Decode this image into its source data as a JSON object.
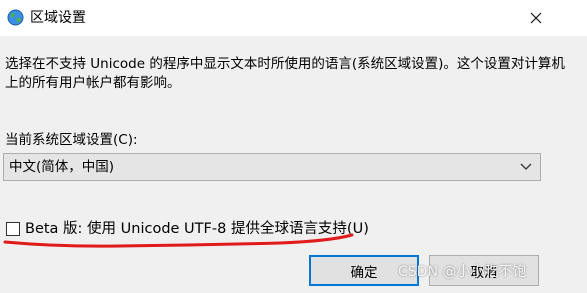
{
  "window": {
    "title": "区域设置",
    "icon": "globe-icon",
    "close_label": "✕"
  },
  "description": "选择在不支持 Unicode 的程序中显示文本时所使用的语言(系统区域设置)。这个设置对计算机上的所有用户帐户都有影响。",
  "current_locale": {
    "label": "当前系统区域设置(C):",
    "value": "中文(简体，中国)"
  },
  "beta_option": {
    "label": "Beta 版: 使用 Unicode UTF-8 提供全球语言支持(U)",
    "checked": false,
    "annotation_color": "#e01b1b"
  },
  "buttons": {
    "ok": "确定",
    "cancel": "取消"
  },
  "watermark": "CSDN @小小吃不饱",
  "colors": {
    "accent": "#0078d7",
    "dialog_bg": "#f0f0f0"
  }
}
